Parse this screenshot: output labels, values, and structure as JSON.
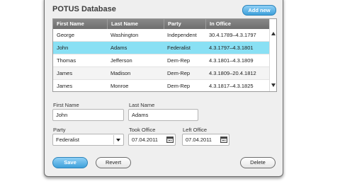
{
  "app": {
    "title": "POTUS Database",
    "add_label": "Add new"
  },
  "table": {
    "headers": [
      "First Name",
      "Last Name",
      "Party",
      "In Office"
    ],
    "rows": [
      [
        "George",
        "Washington",
        "Independent",
        "30.4.1789–4.3.1797"
      ],
      [
        "John",
        "Adams",
        "Federalist",
        "4.3.1797–4.3.1801"
      ],
      [
        "Thomas",
        "Jefferson",
        "Dem-Rep",
        "4.3.1801–4.3.1809"
      ],
      [
        "James",
        "Madison",
        "Dem-Rep",
        "4.3.1809–20.4.1812"
      ],
      [
        "James",
        "Monroe",
        "Dem-Rep",
        "4.3.1817–4.3.1825"
      ]
    ],
    "selected_row": 1
  },
  "form": {
    "first_name_label": "First Name",
    "first_name_value": "John",
    "last_name_label": "Last Name",
    "last_name_value": "Adams",
    "party_label": "Party",
    "party_value": "Federalist",
    "took_office_label": "Took Office",
    "took_office_value": "07.04.2011",
    "left_office_label": "Left Office",
    "left_office_value": "07.04.2011"
  },
  "actions": {
    "save_label": "Save",
    "revert_label": "Revert",
    "delete_label": "Delete"
  },
  "colors": {
    "accent": "#3ea0da",
    "selection": "#89e0f4",
    "header": "#7a7a7a"
  },
  "icons": {
    "scroll_up": "triangle-up-icon",
    "scroll_down": "triangle-down-icon",
    "dropdown": "chevron-down-icon",
    "date": "calendar-icon"
  }
}
